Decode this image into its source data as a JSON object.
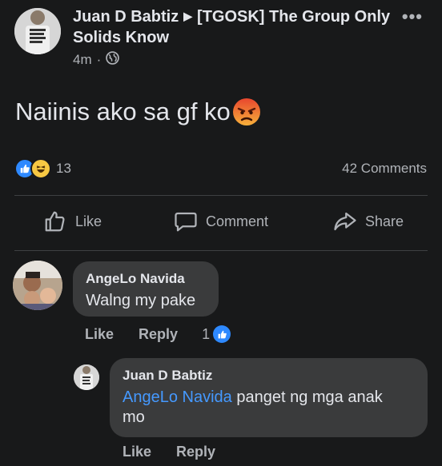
{
  "post": {
    "author": "Juan D Babtiz",
    "group": "[TGOSK] The Group Only Solids Know",
    "time": "4m",
    "separator": "·",
    "text": "Naiinis ako sa gf ko",
    "more_label": "•••",
    "reactions": {
      "icons": [
        "like-reaction-icon",
        "haha-reaction-icon"
      ],
      "count": "13"
    },
    "comment_count": "42 Comments"
  },
  "actions": {
    "like": "Like",
    "comment": "Comment",
    "share": "Share"
  },
  "comments": [
    {
      "author": "AngeLo Navida",
      "text": "Walng my pake",
      "like_label": "Like",
      "reply_label": "Reply",
      "like_count": "1"
    }
  ],
  "reply": {
    "author": "Juan D Babtiz",
    "mention": "AngeLo Navida",
    "text_line1": " panget ng mga anak",
    "text_line2": "mo",
    "like_label": "Like",
    "reply_label": "Reply"
  },
  "colors": {
    "background": "#18191a",
    "bubble": "#3a3b3c",
    "mention": "#4599ff",
    "like_blue": "#2e89ff"
  }
}
